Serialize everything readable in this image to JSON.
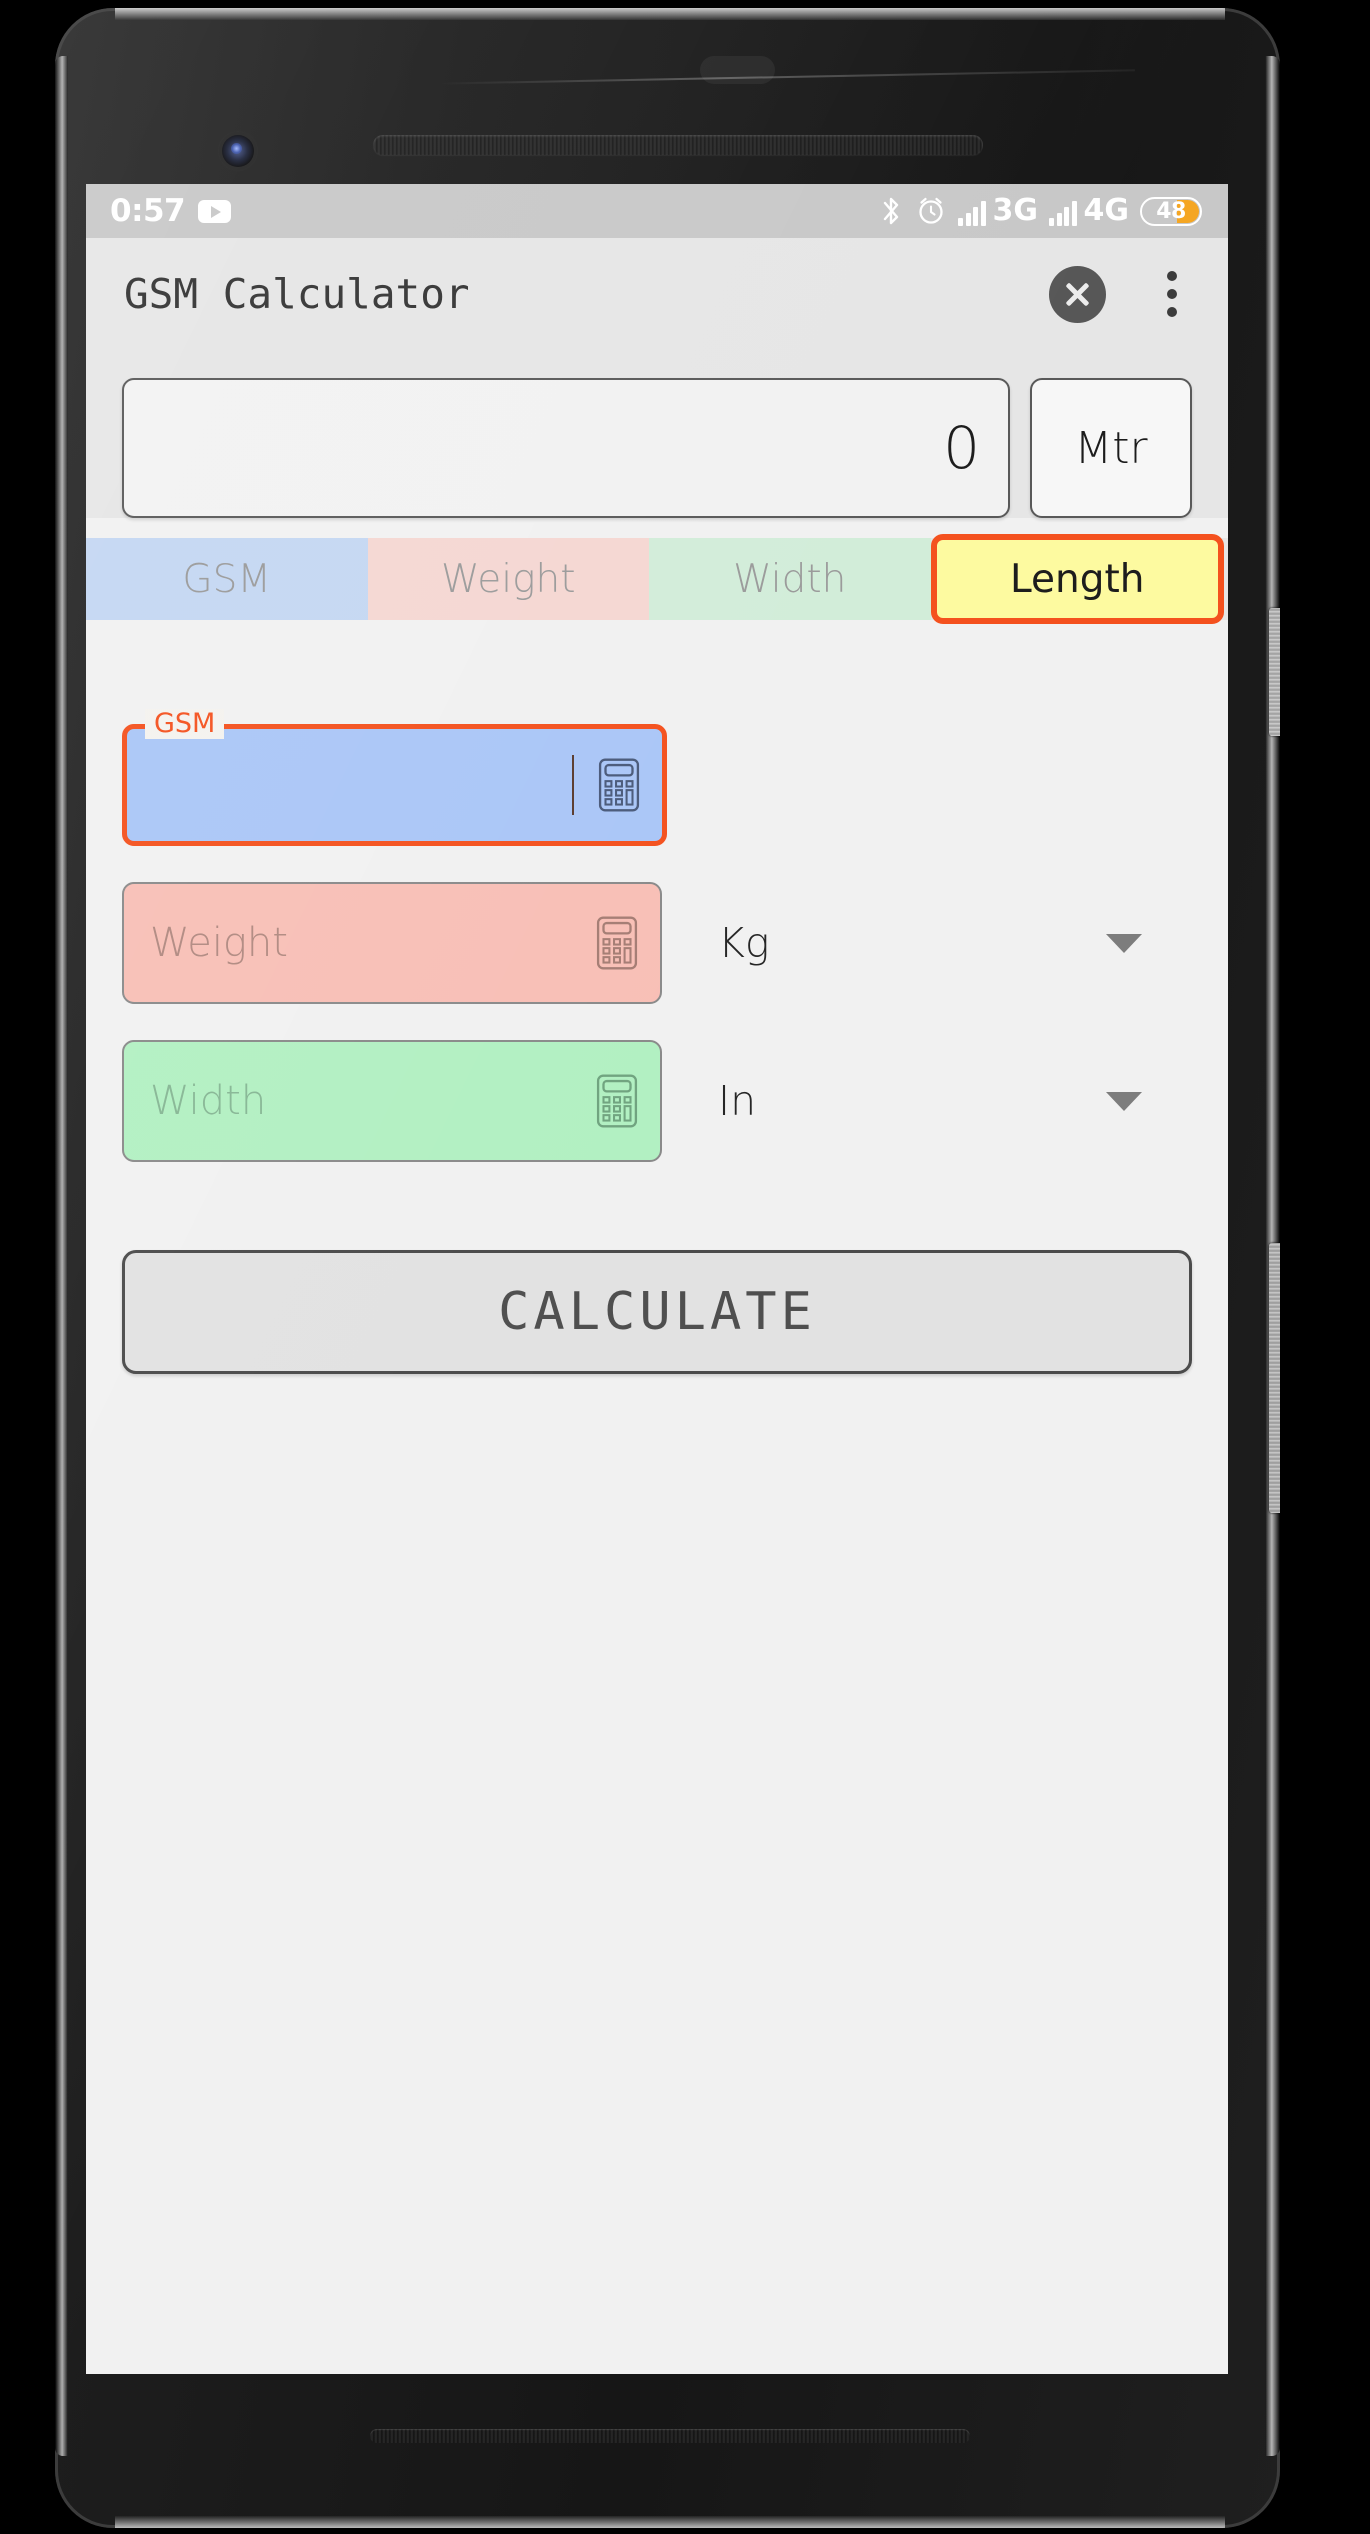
{
  "status_bar": {
    "clock": "0:57",
    "app_icon": "youtube-play-icon",
    "bluetooth_icon": "bluetooth-icon",
    "alarm_icon": "alarm-clock-icon",
    "sim1_network": "3G",
    "sim2_network": "4G",
    "battery_percent": "48",
    "battery_accent": "#f5a623"
  },
  "app_bar": {
    "title": "GSM Calculator",
    "close_icon": "close-circle-icon",
    "overflow_icon": "overflow-menu-icon"
  },
  "display": {
    "result_value": "0",
    "result_unit": "Mtr"
  },
  "tabs": [
    {
      "label": "GSM",
      "color": "#c4d7f2",
      "selected": false
    },
    {
      "label": "Weight",
      "color": "#f5d7d2",
      "selected": false
    },
    {
      "label": "Width",
      "color": "#d2edd9",
      "selected": false
    },
    {
      "label": "Length",
      "color": "#fdfaa0",
      "selected": true
    }
  ],
  "selected_tab_accent": "#f4511e",
  "fields": [
    {
      "name": "gsm",
      "floating_label": "GSM",
      "placeholder": "",
      "value": "",
      "fill": "#aac6f7",
      "focused": true,
      "keypad_icon": "calculator-icon",
      "unit": null
    },
    {
      "name": "weight",
      "floating_label": "",
      "placeholder": "Weight",
      "value": "",
      "fill": "#f8bfb6",
      "focused": false,
      "keypad_icon": "calculator-icon",
      "unit": "Kg"
    },
    {
      "name": "width",
      "floating_label": "",
      "placeholder": "Width",
      "value": "",
      "fill": "#b2f0c2",
      "focused": false,
      "keypad_icon": "calculator-icon",
      "unit": "In"
    }
  ],
  "actions": {
    "calculate_label": "CALCULATE"
  }
}
